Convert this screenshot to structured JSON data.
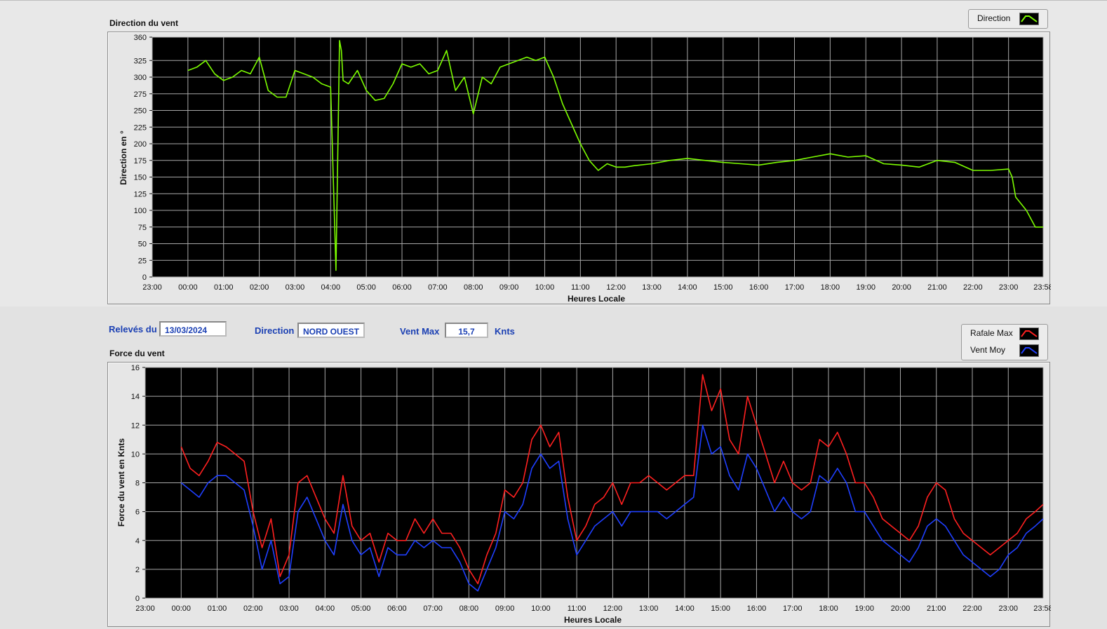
{
  "top_chart": {
    "title": "Direction du vent",
    "legend": {
      "label": "Direction",
      "color": "#7cfc00"
    },
    "xlabel": "Heures Locale",
    "ylabel": "Direction en °"
  },
  "info_bar": {
    "releves_label": "Relevés du",
    "date_value": "13/03/2024",
    "direction_label": "Direction",
    "direction_value": "NORD OUEST",
    "ventmax_label": "Vent Max",
    "ventmax_value": "15,7",
    "unit_label": "Knts"
  },
  "bottom_chart": {
    "title": "Force du vent",
    "legend": [
      {
        "label": "Rafale Max",
        "color": "#ff2020"
      },
      {
        "label": "Vent Moy",
        "color": "#1f3fff"
      }
    ],
    "xlabel": "Heures Locale",
    "ylabel": "Force du vent en Knts"
  },
  "chart_data": [
    {
      "type": "line",
      "title": "Direction du vent",
      "xlabel": "Heures Locale",
      "ylabel": "Direction en °",
      "x_ticks": [
        "23:00",
        "00:00",
        "01:00",
        "02:00",
        "03:00",
        "04:00",
        "05:00",
        "06:00",
        "07:00",
        "08:00",
        "09:00",
        "10:00",
        "11:00",
        "12:00",
        "13:00",
        "14:00",
        "15:00",
        "16:00",
        "17:00",
        "18:00",
        "19:00",
        "20:00",
        "21:00",
        "22:00",
        "23:00",
        "23:58"
      ],
      "y_ticks": [
        0,
        25,
        50,
        75,
        100,
        125,
        150,
        175,
        200,
        225,
        250,
        275,
        300,
        325,
        360
      ],
      "ylim": [
        0,
        360
      ],
      "xlim_hours": [
        0,
        24.97
      ],
      "grid": true,
      "legend_placement": "top-right",
      "series": [
        {
          "name": "Direction",
          "color": "#7cfc00",
          "x": [
            1.0,
            1.25,
            1.5,
            1.75,
            2.0,
            2.25,
            2.5,
            2.75,
            3.0,
            3.25,
            3.5,
            3.75,
            4.0,
            4.25,
            4.5,
            4.75,
            5.0,
            5.15,
            5.25,
            5.3,
            5.35,
            5.5,
            5.75,
            6.0,
            6.25,
            6.5,
            6.75,
            7.0,
            7.25,
            7.5,
            7.75,
            8.0,
            8.25,
            8.5,
            8.75,
            9.0,
            9.25,
            9.5,
            9.75,
            10.0,
            10.25,
            10.5,
            10.75,
            11.0,
            11.25,
            11.5,
            11.75,
            12.0,
            12.25,
            12.5,
            12.75,
            13.0,
            13.25,
            13.5,
            14.0,
            14.5,
            15.0,
            15.5,
            16.0,
            16.5,
            17.0,
            17.5,
            18.0,
            18.5,
            19.0,
            19.5,
            20.0,
            20.5,
            21.0,
            21.5,
            22.0,
            22.5,
            23.0,
            23.5,
            24.0,
            24.1,
            24.2,
            24.5,
            24.75,
            24.97
          ],
          "y": [
            310,
            315,
            325,
            305,
            295,
            300,
            310,
            305,
            330,
            280,
            270,
            270,
            310,
            305,
            300,
            290,
            285,
            10,
            355,
            340,
            295,
            290,
            310,
            280,
            265,
            268,
            290,
            320,
            315,
            320,
            305,
            310,
            340,
            280,
            300,
            245,
            300,
            290,
            315,
            320,
            325,
            330,
            325,
            330,
            300,
            260,
            230,
            200,
            175,
            160,
            170,
            165,
            165,
            167,
            170,
            175,
            178,
            175,
            172,
            170,
            168,
            172,
            175,
            180,
            185,
            180,
            182,
            170,
            168,
            165,
            175,
            172,
            160,
            160,
            162,
            150,
            120,
            100,
            75,
            75
          ]
        }
      ]
    },
    {
      "type": "line",
      "title": "Force du vent",
      "xlabel": "Heures Locale",
      "ylabel": "Force du vent en Knts",
      "x_ticks": [
        "23:00",
        "00:00",
        "01:00",
        "02:00",
        "03:00",
        "04:00",
        "05:00",
        "06:00",
        "07:00",
        "08:00",
        "09:00",
        "10:00",
        "11:00",
        "12:00",
        "13:00",
        "14:00",
        "15:00",
        "16:00",
        "17:00",
        "18:00",
        "19:00",
        "20:00",
        "21:00",
        "22:00",
        "23:00",
        "23:58"
      ],
      "y_ticks": [
        0,
        2,
        4,
        6,
        8,
        10,
        12,
        14,
        16
      ],
      "ylim": [
        0,
        16
      ],
      "xlim_hours": [
        0,
        24.97
      ],
      "grid": true,
      "legend_placement": "top-right",
      "series": [
        {
          "name": "Rafale Max",
          "color": "#ff2020",
          "x": [
            1.0,
            1.25,
            1.5,
            1.75,
            2.0,
            2.25,
            2.5,
            2.75,
            3.0,
            3.25,
            3.5,
            3.75,
            4.0,
            4.25,
            4.5,
            4.75,
            5.0,
            5.25,
            5.5,
            5.75,
            6.0,
            6.25,
            6.5,
            6.75,
            7.0,
            7.25,
            7.5,
            7.75,
            8.0,
            8.25,
            8.5,
            8.75,
            9.0,
            9.25,
            9.5,
            9.75,
            10.0,
            10.25,
            10.5,
            10.75,
            11.0,
            11.25,
            11.5,
            11.75,
            12.0,
            12.25,
            12.5,
            12.75,
            13.0,
            13.25,
            13.5,
            13.75,
            14.0,
            14.25,
            14.5,
            14.75,
            15.0,
            15.25,
            15.5,
            15.75,
            16.0,
            16.25,
            16.5,
            16.75,
            17.0,
            17.25,
            17.5,
            17.75,
            18.0,
            18.25,
            18.5,
            18.75,
            19.0,
            19.25,
            19.5,
            19.75,
            20.0,
            20.25,
            20.5,
            20.75,
            21.0,
            21.25,
            21.5,
            21.75,
            22.0,
            22.25,
            22.5,
            22.75,
            23.0,
            23.25,
            23.5,
            23.75,
            24.0,
            24.25,
            24.5,
            24.75,
            24.97
          ],
          "y": [
            10.5,
            9.0,
            8.5,
            9.5,
            10.8,
            10.5,
            10.0,
            9.5,
            6.0,
            3.5,
            5.5,
            1.5,
            3.0,
            8.0,
            8.5,
            7.0,
            5.5,
            4.5,
            8.5,
            5.0,
            4.0,
            4.5,
            2.5,
            4.5,
            4.0,
            4.0,
            5.5,
            4.5,
            5.5,
            4.5,
            4.5,
            3.5,
            2.0,
            1.0,
            3.0,
            4.5,
            7.5,
            7.0,
            8.0,
            11.0,
            12.0,
            10.5,
            11.5,
            7.0,
            4.0,
            5.0,
            6.5,
            7.0,
            8.0,
            6.5,
            8.0,
            8.0,
            8.5,
            8.0,
            7.5,
            8.0,
            8.5,
            8.5,
            15.5,
            13.0,
            14.5,
            11.0,
            10.0,
            14.0,
            12.0,
            10.0,
            8.0,
            9.5,
            8.0,
            7.5,
            8.0,
            11.0,
            10.5,
            11.5,
            10.0,
            8.0,
            8.0,
            7.0,
            5.5,
            5.0,
            4.5,
            4.0,
            5.0,
            7.0,
            8.0,
            7.5,
            5.5,
            4.5,
            4.0,
            3.5,
            3.0,
            3.5,
            4.0,
            4.5,
            5.5,
            6.0,
            6.5
          ]
        },
        {
          "name": "Vent Moy",
          "color": "#1f3fff",
          "x": [
            1.0,
            1.25,
            1.5,
            1.75,
            2.0,
            2.25,
            2.5,
            2.75,
            3.0,
            3.25,
            3.5,
            3.75,
            4.0,
            4.25,
            4.5,
            4.75,
            5.0,
            5.25,
            5.5,
            5.75,
            6.0,
            6.25,
            6.5,
            6.75,
            7.0,
            7.25,
            7.5,
            7.75,
            8.0,
            8.25,
            8.5,
            8.75,
            9.0,
            9.25,
            9.5,
            9.75,
            10.0,
            10.25,
            10.5,
            10.75,
            11.0,
            11.25,
            11.5,
            11.75,
            12.0,
            12.25,
            12.5,
            12.75,
            13.0,
            13.25,
            13.5,
            13.75,
            14.0,
            14.25,
            14.5,
            14.75,
            15.0,
            15.25,
            15.5,
            15.75,
            16.0,
            16.25,
            16.5,
            16.75,
            17.0,
            17.25,
            17.5,
            17.75,
            18.0,
            18.25,
            18.5,
            18.75,
            19.0,
            19.25,
            19.5,
            19.75,
            20.0,
            20.25,
            20.5,
            20.75,
            21.0,
            21.25,
            21.5,
            21.75,
            22.0,
            22.25,
            22.5,
            22.75,
            23.0,
            23.25,
            23.5,
            23.75,
            24.0,
            24.25,
            24.5,
            24.75,
            24.97
          ],
          "y": [
            8.0,
            7.5,
            7.0,
            8.0,
            8.5,
            8.5,
            8.0,
            7.5,
            5.0,
            2.0,
            4.0,
            1.0,
            1.5,
            6.0,
            7.0,
            5.5,
            4.0,
            3.0,
            6.5,
            4.0,
            3.0,
            3.5,
            1.5,
            3.5,
            3.0,
            3.0,
            4.0,
            3.5,
            4.0,
            3.5,
            3.5,
            2.5,
            1.0,
            0.5,
            2.0,
            3.5,
            6.0,
            5.5,
            6.5,
            9.0,
            10.0,
            9.0,
            9.5,
            5.5,
            3.0,
            4.0,
            5.0,
            5.5,
            6.0,
            5.0,
            6.0,
            6.0,
            6.0,
            6.0,
            5.5,
            6.0,
            6.5,
            7.0,
            12.0,
            10.0,
            10.5,
            8.5,
            7.5,
            10.0,
            9.0,
            7.5,
            6.0,
            7.0,
            6.0,
            5.5,
            6.0,
            8.5,
            8.0,
            9.0,
            8.0,
            6.0,
            6.0,
            5.0,
            4.0,
            3.5,
            3.0,
            2.5,
            3.5,
            5.0,
            5.5,
            5.0,
            4.0,
            3.0,
            2.5,
            2.0,
            1.5,
            2.0,
            3.0,
            3.5,
            4.5,
            5.0,
            5.5
          ]
        }
      ]
    }
  ]
}
